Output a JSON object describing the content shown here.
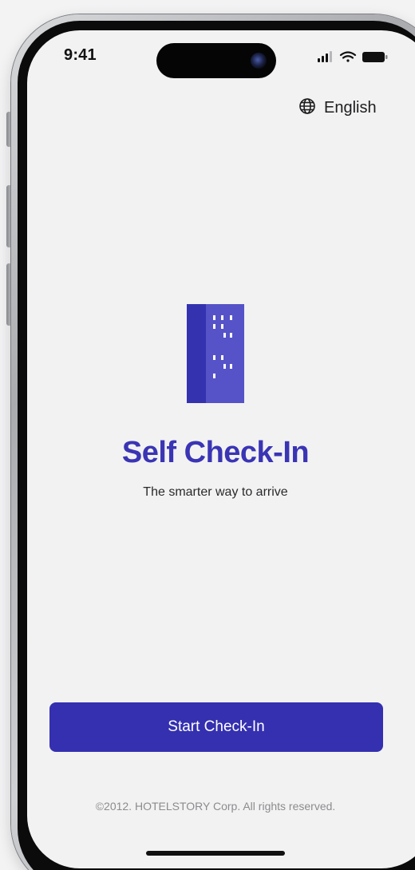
{
  "status_bar": {
    "time": "9:41"
  },
  "language": {
    "label": "English",
    "icon": "globe-icon"
  },
  "hero": {
    "logo_icon": "building-icon",
    "title": "Self Check-In",
    "subtitle": "The smarter way to arrive"
  },
  "actions": {
    "start_label": "Start Check-In"
  },
  "footer": {
    "copyright": "©2012. HOTELSTORY Corp. All rights reserved."
  },
  "colors": {
    "brand": "#3430b0",
    "title": "#3a35b4",
    "background": "#f2f2f2"
  }
}
